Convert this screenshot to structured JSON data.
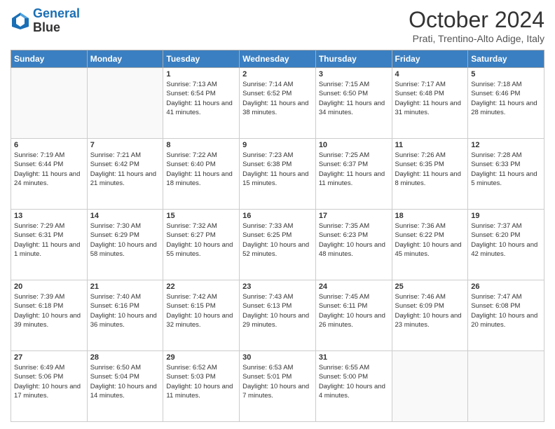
{
  "header": {
    "logo_line1": "General",
    "logo_line2": "Blue",
    "month": "October 2024",
    "location": "Prati, Trentino-Alto Adige, Italy"
  },
  "days_of_week": [
    "Sunday",
    "Monday",
    "Tuesday",
    "Wednesday",
    "Thursday",
    "Friday",
    "Saturday"
  ],
  "weeks": [
    [
      {
        "num": "",
        "sunrise": "",
        "sunset": "",
        "daylight": ""
      },
      {
        "num": "",
        "sunrise": "",
        "sunset": "",
        "daylight": ""
      },
      {
        "num": "1",
        "sunrise": "Sunrise: 7:13 AM",
        "sunset": "Sunset: 6:54 PM",
        "daylight": "Daylight: 11 hours and 41 minutes."
      },
      {
        "num": "2",
        "sunrise": "Sunrise: 7:14 AM",
        "sunset": "Sunset: 6:52 PM",
        "daylight": "Daylight: 11 hours and 38 minutes."
      },
      {
        "num": "3",
        "sunrise": "Sunrise: 7:15 AM",
        "sunset": "Sunset: 6:50 PM",
        "daylight": "Daylight: 11 hours and 34 minutes."
      },
      {
        "num": "4",
        "sunrise": "Sunrise: 7:17 AM",
        "sunset": "Sunset: 6:48 PM",
        "daylight": "Daylight: 11 hours and 31 minutes."
      },
      {
        "num": "5",
        "sunrise": "Sunrise: 7:18 AM",
        "sunset": "Sunset: 6:46 PM",
        "daylight": "Daylight: 11 hours and 28 minutes."
      }
    ],
    [
      {
        "num": "6",
        "sunrise": "Sunrise: 7:19 AM",
        "sunset": "Sunset: 6:44 PM",
        "daylight": "Daylight: 11 hours and 24 minutes."
      },
      {
        "num": "7",
        "sunrise": "Sunrise: 7:21 AM",
        "sunset": "Sunset: 6:42 PM",
        "daylight": "Daylight: 11 hours and 21 minutes."
      },
      {
        "num": "8",
        "sunrise": "Sunrise: 7:22 AM",
        "sunset": "Sunset: 6:40 PM",
        "daylight": "Daylight: 11 hours and 18 minutes."
      },
      {
        "num": "9",
        "sunrise": "Sunrise: 7:23 AM",
        "sunset": "Sunset: 6:38 PM",
        "daylight": "Daylight: 11 hours and 15 minutes."
      },
      {
        "num": "10",
        "sunrise": "Sunrise: 7:25 AM",
        "sunset": "Sunset: 6:37 PM",
        "daylight": "Daylight: 11 hours and 11 minutes."
      },
      {
        "num": "11",
        "sunrise": "Sunrise: 7:26 AM",
        "sunset": "Sunset: 6:35 PM",
        "daylight": "Daylight: 11 hours and 8 minutes."
      },
      {
        "num": "12",
        "sunrise": "Sunrise: 7:28 AM",
        "sunset": "Sunset: 6:33 PM",
        "daylight": "Daylight: 11 hours and 5 minutes."
      }
    ],
    [
      {
        "num": "13",
        "sunrise": "Sunrise: 7:29 AM",
        "sunset": "Sunset: 6:31 PM",
        "daylight": "Daylight: 11 hours and 1 minute."
      },
      {
        "num": "14",
        "sunrise": "Sunrise: 7:30 AM",
        "sunset": "Sunset: 6:29 PM",
        "daylight": "Daylight: 10 hours and 58 minutes."
      },
      {
        "num": "15",
        "sunrise": "Sunrise: 7:32 AM",
        "sunset": "Sunset: 6:27 PM",
        "daylight": "Daylight: 10 hours and 55 minutes."
      },
      {
        "num": "16",
        "sunrise": "Sunrise: 7:33 AM",
        "sunset": "Sunset: 6:25 PM",
        "daylight": "Daylight: 10 hours and 52 minutes."
      },
      {
        "num": "17",
        "sunrise": "Sunrise: 7:35 AM",
        "sunset": "Sunset: 6:23 PM",
        "daylight": "Daylight: 10 hours and 48 minutes."
      },
      {
        "num": "18",
        "sunrise": "Sunrise: 7:36 AM",
        "sunset": "Sunset: 6:22 PM",
        "daylight": "Daylight: 10 hours and 45 minutes."
      },
      {
        "num": "19",
        "sunrise": "Sunrise: 7:37 AM",
        "sunset": "Sunset: 6:20 PM",
        "daylight": "Daylight: 10 hours and 42 minutes."
      }
    ],
    [
      {
        "num": "20",
        "sunrise": "Sunrise: 7:39 AM",
        "sunset": "Sunset: 6:18 PM",
        "daylight": "Daylight: 10 hours and 39 minutes."
      },
      {
        "num": "21",
        "sunrise": "Sunrise: 7:40 AM",
        "sunset": "Sunset: 6:16 PM",
        "daylight": "Daylight: 10 hours and 36 minutes."
      },
      {
        "num": "22",
        "sunrise": "Sunrise: 7:42 AM",
        "sunset": "Sunset: 6:15 PM",
        "daylight": "Daylight: 10 hours and 32 minutes."
      },
      {
        "num": "23",
        "sunrise": "Sunrise: 7:43 AM",
        "sunset": "Sunset: 6:13 PM",
        "daylight": "Daylight: 10 hours and 29 minutes."
      },
      {
        "num": "24",
        "sunrise": "Sunrise: 7:45 AM",
        "sunset": "Sunset: 6:11 PM",
        "daylight": "Daylight: 10 hours and 26 minutes."
      },
      {
        "num": "25",
        "sunrise": "Sunrise: 7:46 AM",
        "sunset": "Sunset: 6:09 PM",
        "daylight": "Daylight: 10 hours and 23 minutes."
      },
      {
        "num": "26",
        "sunrise": "Sunrise: 7:47 AM",
        "sunset": "Sunset: 6:08 PM",
        "daylight": "Daylight: 10 hours and 20 minutes."
      }
    ],
    [
      {
        "num": "27",
        "sunrise": "Sunrise: 6:49 AM",
        "sunset": "Sunset: 5:06 PM",
        "daylight": "Daylight: 10 hours and 17 minutes."
      },
      {
        "num": "28",
        "sunrise": "Sunrise: 6:50 AM",
        "sunset": "Sunset: 5:04 PM",
        "daylight": "Daylight: 10 hours and 14 minutes."
      },
      {
        "num": "29",
        "sunrise": "Sunrise: 6:52 AM",
        "sunset": "Sunset: 5:03 PM",
        "daylight": "Daylight: 10 hours and 11 minutes."
      },
      {
        "num": "30",
        "sunrise": "Sunrise: 6:53 AM",
        "sunset": "Sunset: 5:01 PM",
        "daylight": "Daylight: 10 hours and 7 minutes."
      },
      {
        "num": "31",
        "sunrise": "Sunrise: 6:55 AM",
        "sunset": "Sunset: 5:00 PM",
        "daylight": "Daylight: 10 hours and 4 minutes."
      },
      {
        "num": "",
        "sunrise": "",
        "sunset": "",
        "daylight": ""
      },
      {
        "num": "",
        "sunrise": "",
        "sunset": "",
        "daylight": ""
      }
    ]
  ]
}
